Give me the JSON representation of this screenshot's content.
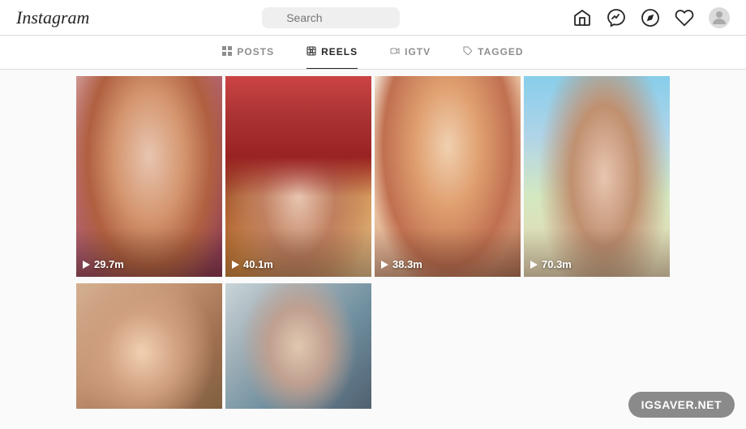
{
  "header": {
    "logo": "Instagram",
    "search_placeholder": "Search"
  },
  "tabs": [
    {
      "id": "posts",
      "label": "POSTS",
      "icon": "grid-icon",
      "active": false
    },
    {
      "id": "reels",
      "label": "REELS",
      "icon": "reels-icon",
      "active": true
    },
    {
      "id": "igtv",
      "label": "IGTV",
      "icon": "igtv-icon",
      "active": false
    },
    {
      "id": "tagged",
      "label": "TAGGED",
      "icon": "tag-icon",
      "active": false
    }
  ],
  "reels": [
    {
      "id": 1,
      "views": "29.7m",
      "img_class": "img-1"
    },
    {
      "id": 2,
      "views": "40.1m",
      "img_class": "img-2"
    },
    {
      "id": 3,
      "views": "38.3m",
      "img_class": "img-3"
    },
    {
      "id": 4,
      "views": "70.3m",
      "img_class": "img-4"
    },
    {
      "id": 5,
      "views": "",
      "img_class": "img-5"
    },
    {
      "id": 6,
      "views": "",
      "img_class": "img-6"
    }
  ],
  "watermark": "IGSAVER.NET"
}
